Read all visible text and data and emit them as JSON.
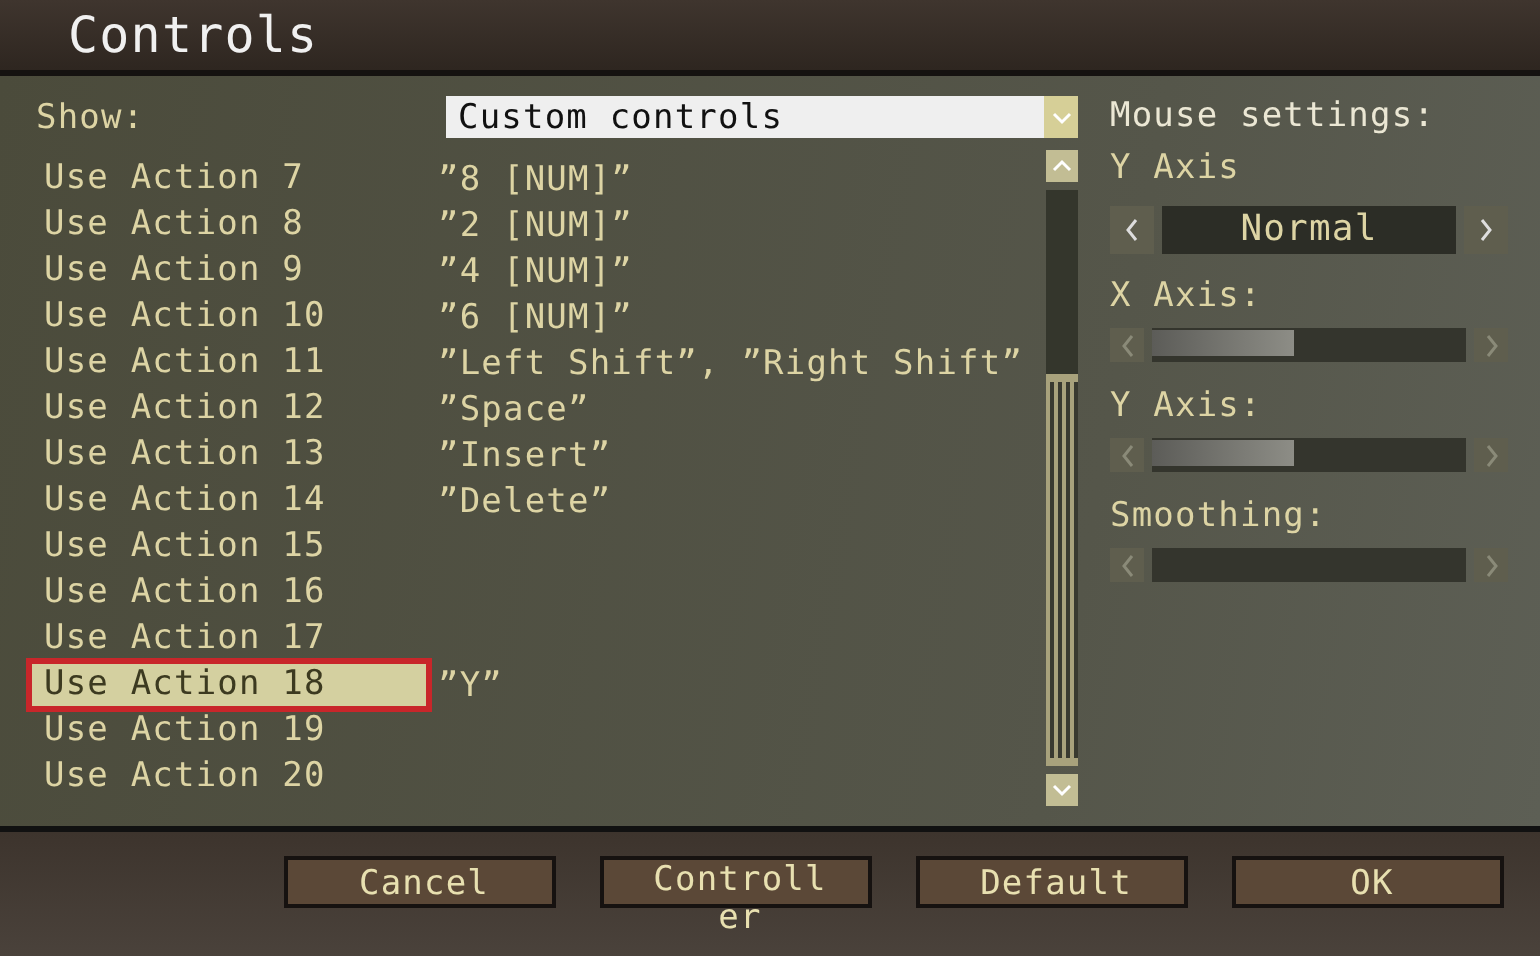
{
  "window": {
    "title": "Controls"
  },
  "show": {
    "label": "Show:",
    "value": "Custom controls"
  },
  "bindings": [
    {
      "action": "Use Action 7",
      "key": "”8 [NUM]”",
      "selected": false
    },
    {
      "action": "Use Action 8",
      "key": "”2 [NUM]”",
      "selected": false
    },
    {
      "action": "Use Action 9",
      "key": "”4 [NUM]”",
      "selected": false
    },
    {
      "action": "Use Action 10",
      "key": "”6 [NUM]”",
      "selected": false
    },
    {
      "action": "Use Action 11",
      "key": "”Left Shift”, ”Right Shift”",
      "selected": false
    },
    {
      "action": "Use Action 12",
      "key": "”Space”",
      "selected": false
    },
    {
      "action": "Use Action 13",
      "key": "”Insert”",
      "selected": false
    },
    {
      "action": "Use Action 14",
      "key": "”Delete”",
      "selected": false
    },
    {
      "action": "Use Action 15",
      "selected": false
    },
    {
      "action": "Use Action 16",
      "selected": false
    },
    {
      "action": "Use Action 17",
      "selected": false
    },
    {
      "action": "Use Action 18",
      "key": "”Y”",
      "selected": true
    },
    {
      "action": "Use Action 19",
      "selected": false
    },
    {
      "action": "Use Action 20",
      "selected": false
    }
  ],
  "mouse": {
    "title": "Mouse settings:",
    "settings": [
      {
        "kind": "choice",
        "label": "Y Axis",
        "value": "Normal"
      },
      {
        "kind": "slider",
        "label": "X Axis:",
        "level": 0.45
      },
      {
        "kind": "slider",
        "label": "Y Axis:",
        "level": 0.45
      },
      {
        "kind": "slider",
        "label": "Smoothing:"
      }
    ]
  },
  "buttons": [
    "Cancel",
    "Controller",
    "Default",
    "OK"
  ]
}
